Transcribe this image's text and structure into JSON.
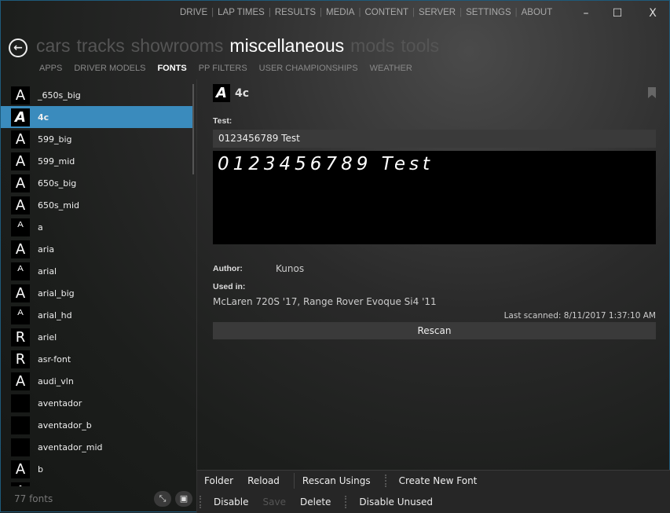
{
  "topnav": [
    "DRIVE",
    "LAP TIMES",
    "RESULTS",
    "MEDIA",
    "CONTENT",
    "SERVER",
    "SETTINGS",
    "ABOUT"
  ],
  "window": {
    "minimize": "–",
    "maximize": "☐",
    "close": "X"
  },
  "back_icon": "arrow-left-icon",
  "bigtabs": [
    "cars",
    "tracks",
    "showrooms",
    "miscellaneous",
    "mods",
    "tools"
  ],
  "bigtabs_active": "miscellaneous",
  "subtabs": [
    "APPS",
    "DRIVER MODELS",
    "FONTS",
    "PP FILTERS",
    "USER CHAMPIONSHIPS",
    "WEATHER"
  ],
  "subtabs_active": "FONTS",
  "list": [
    {
      "name": "_650s_big",
      "glyph": "A"
    },
    {
      "name": "4c",
      "glyph": "A",
      "selected": true
    },
    {
      "name": "599_big",
      "glyph": "A"
    },
    {
      "name": "599_mid",
      "glyph": "A"
    },
    {
      "name": "650s_big",
      "glyph": "A"
    },
    {
      "name": "650s_mid",
      "glyph": "A"
    },
    {
      "name": "a",
      "glyph": "ᴬ"
    },
    {
      "name": "aria",
      "glyph": "A"
    },
    {
      "name": "arial",
      "glyph": "ᴬ"
    },
    {
      "name": "arial_big",
      "glyph": "A"
    },
    {
      "name": "arial_hd",
      "glyph": "ᴬ"
    },
    {
      "name": "ariel",
      "glyph": "R"
    },
    {
      "name": "asr-font",
      "glyph": "R"
    },
    {
      "name": "audi_vln",
      "glyph": "A"
    },
    {
      "name": "aventador",
      "glyph": ""
    },
    {
      "name": "aventador_b",
      "glyph": ""
    },
    {
      "name": "aventador_mid",
      "glyph": ""
    },
    {
      "name": "b",
      "glyph": "A"
    },
    {
      "name": "",
      "glyph": "A"
    }
  ],
  "count": "77 fonts",
  "accent": "#3a8bbd",
  "detail": {
    "glyph": "A",
    "name": "4c",
    "test_label": "Test:",
    "test_value": "0123456789 Test",
    "preview": "0123456789 Test",
    "author_label": "Author:",
    "author": "Kunos",
    "used_label": "Used in:",
    "used": "McLaren 720S '17, Range Rover Evoque Si4 '11",
    "last_scanned": "Last scanned: 8/11/2017 1:37:10 AM",
    "rescan": "Rescan"
  },
  "bottom": {
    "folder": "Folder",
    "reload": "Reload",
    "rescan_usings": "Rescan Usings",
    "create": "Create New Font",
    "disable": "Disable",
    "save": "Save",
    "delete": "Delete",
    "disable_unused": "Disable Unused"
  }
}
